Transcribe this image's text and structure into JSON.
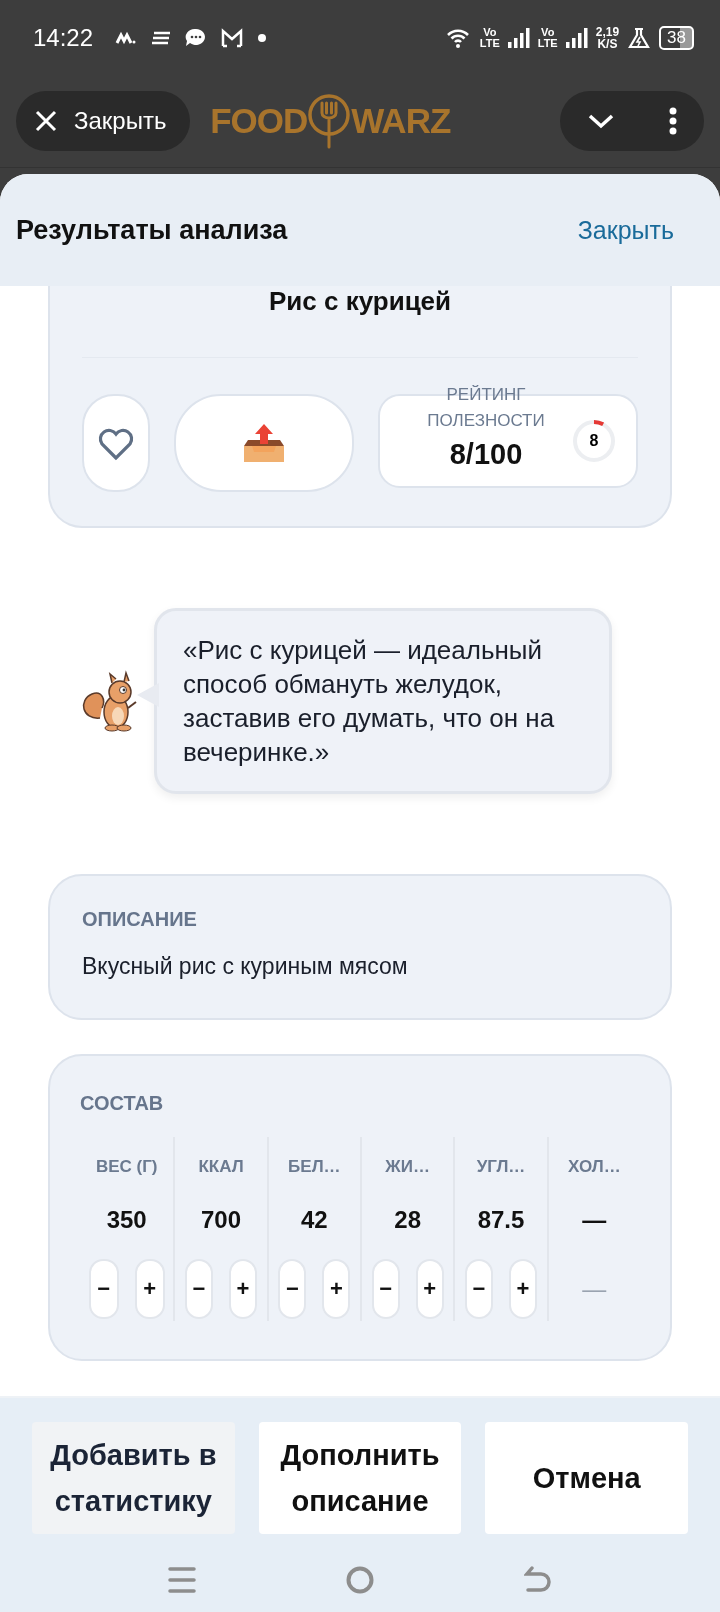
{
  "status_bar": {
    "time": "14:22",
    "network_labels": [
      {
        "top": "Vo",
        "bottom": "LTE"
      },
      {
        "top": "Vo",
        "bottom": "LTE"
      }
    ],
    "speed": {
      "value": "2,19",
      "unit": "K/S"
    },
    "battery": "38"
  },
  "top_bar": {
    "close_button": "Закрыть",
    "logo": {
      "left": "FOOD",
      "right": "WARZ"
    }
  },
  "sheet": {
    "title": "Результаты анализа",
    "close_link": "Закрыть"
  },
  "dish": {
    "name": "Рис с курицей",
    "favorite": {
      "on": false
    },
    "rating": {
      "label": "РЕЙТИНГ ПОЛЕЗНОСТИ",
      "value": "8/100",
      "score": "8"
    }
  },
  "tip": {
    "quote": "«Рис с курицей — идеальный способ обмануть желудок, заставив его думать, что он на вечеринке.»"
  },
  "description": {
    "heading": "ОПИСАНИЕ",
    "text": "Вкусный рис с куриным мясом"
  },
  "composition": {
    "heading": "СОСТАВ",
    "columns": [
      {
        "header": "ВЕС (Г)",
        "value": "350",
        "kind": "stepper",
        "minus": "−",
        "plus": "+"
      },
      {
        "header": "ККАЛ",
        "value": "700",
        "kind": "stepper",
        "minus": "−",
        "plus": "+"
      },
      {
        "header": "БЕЛ…",
        "value": "42",
        "kind": "stepper",
        "minus": "−",
        "plus": "+"
      },
      {
        "header": "ЖИ…",
        "value": "28",
        "kind": "stepper",
        "minus": "−",
        "plus": "+"
      },
      {
        "header": "УГЛ…",
        "value": "87.5",
        "kind": "stepper",
        "minus": "−",
        "plus": "+"
      },
      {
        "header": "ХОЛ…",
        "value": "—",
        "kind": "static",
        "note": "—"
      }
    ]
  },
  "actions": [
    {
      "label": "Добавить в статистику",
      "kind": "muted"
    },
    {
      "label": "Дополнить описание",
      "kind": "plain"
    },
    {
      "label": "Отмена",
      "kind": "plain"
    }
  ]
}
